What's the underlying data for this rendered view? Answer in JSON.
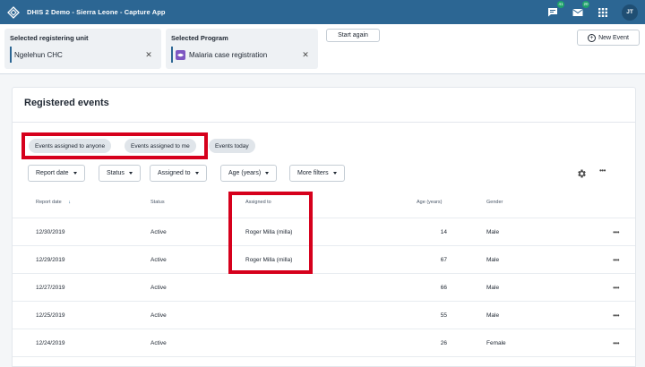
{
  "header": {
    "title": "DHIS 2 Demo - Sierra Leone - Capture App",
    "messages_badge": "41",
    "interpretations_badge": "20",
    "avatar_initials": "JT"
  },
  "context": {
    "org_unit_label": "Selected registering unit",
    "org_unit_value": "Ngelehun CHC",
    "program_label": "Selected Program",
    "program_value": "Malaria case registration",
    "start_again": "Start again",
    "new_event": "New Event"
  },
  "card": {
    "title": "Registered events",
    "chips": [
      "Events assigned to anyone",
      "Events assigned to me",
      "Events today"
    ],
    "filters": [
      "Report date",
      "Status",
      "Assigned to",
      "Age (years)",
      "More filters"
    ]
  },
  "table": {
    "columns": [
      "Report date",
      "Status",
      "Assigned to",
      "Age (years)",
      "Gender"
    ],
    "rows": [
      {
        "date": "12/30/2019",
        "status": "Active",
        "assigned": "Roger Milla (milla)",
        "age": "14",
        "gender": "Male"
      },
      {
        "date": "12/29/2019",
        "status": "Active",
        "assigned": "Roger Milla (milla)",
        "age": "67",
        "gender": "Male"
      },
      {
        "date": "12/27/2019",
        "status": "Active",
        "assigned": "",
        "age": "66",
        "gender": "Male"
      },
      {
        "date": "12/25/2019",
        "status": "Active",
        "assigned": "",
        "age": "55",
        "gender": "Male"
      },
      {
        "date": "12/24/2019",
        "status": "Active",
        "assigned": "",
        "age": "26",
        "gender": "Female"
      }
    ]
  },
  "colors": {
    "header_bg": "#2c6693",
    "highlight": "#d6001c",
    "program_icon": "#7e57c2"
  }
}
